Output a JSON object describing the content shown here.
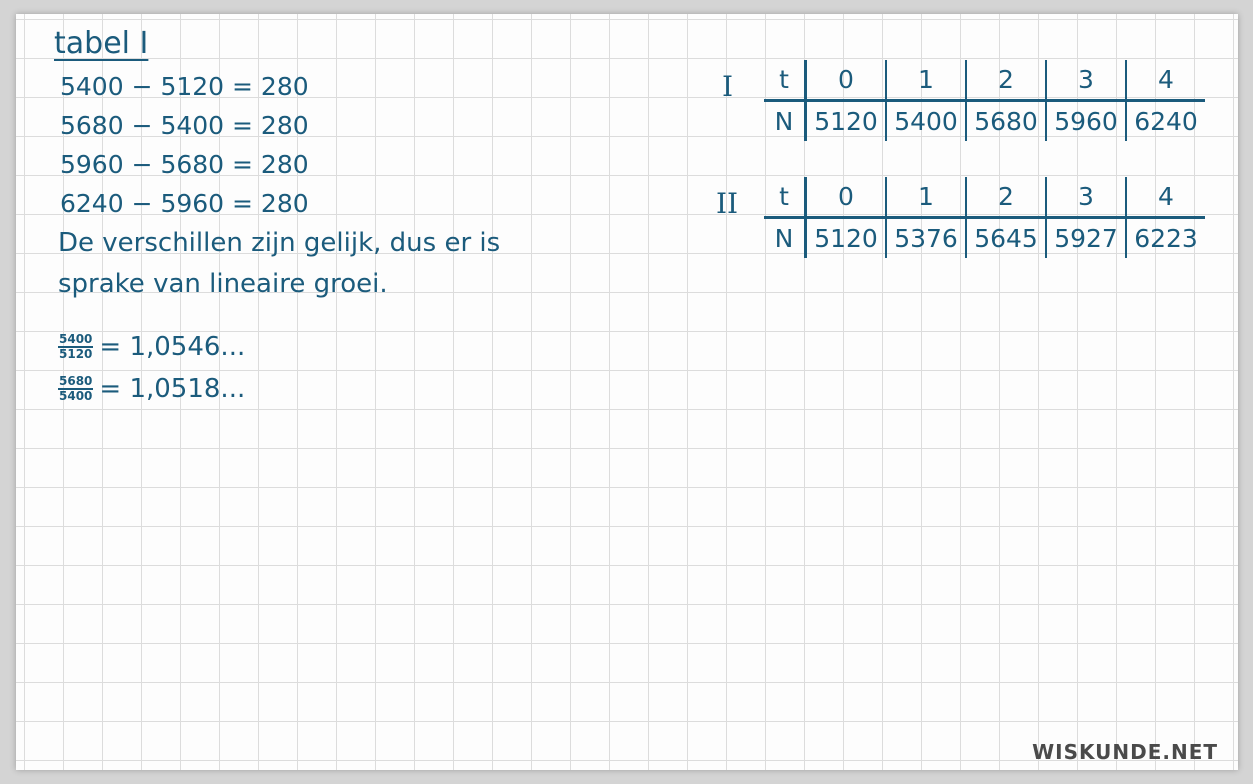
{
  "title": "tabel I",
  "differences": [
    "5400 − 5120 = 280",
    "5680 − 5400 = 280",
    "5960 − 5680 = 280",
    "6240 − 5960 = 280"
  ],
  "conclusion": [
    "De verschillen zijn gelijk, dus er is",
    "sprake van lineaire groei."
  ],
  "ratios": [
    {
      "num": "5400",
      "den": "5120",
      "value": "= 1,0546..."
    },
    {
      "num": "5680",
      "den": "5400",
      "value": "= 1,0518..."
    }
  ],
  "table1": {
    "label": "I",
    "row_t_label": "t",
    "row_n_label": "N",
    "t": [
      "0",
      "1",
      "2",
      "3",
      "4"
    ],
    "n": [
      "5120",
      "5400",
      "5680",
      "5960",
      "6240"
    ]
  },
  "table2": {
    "label": "II",
    "row_t_label": "t",
    "row_n_label": "N",
    "t": [
      "0",
      "1",
      "2",
      "3",
      "4"
    ],
    "n": [
      "5120",
      "5376",
      "5645",
      "5927",
      "6223"
    ]
  },
  "logo": "WISKUNDE.NET",
  "colors": {
    "ink": "#1b5b7c",
    "grid": "#dcdcdc",
    "paper": "#fdfdfd"
  }
}
